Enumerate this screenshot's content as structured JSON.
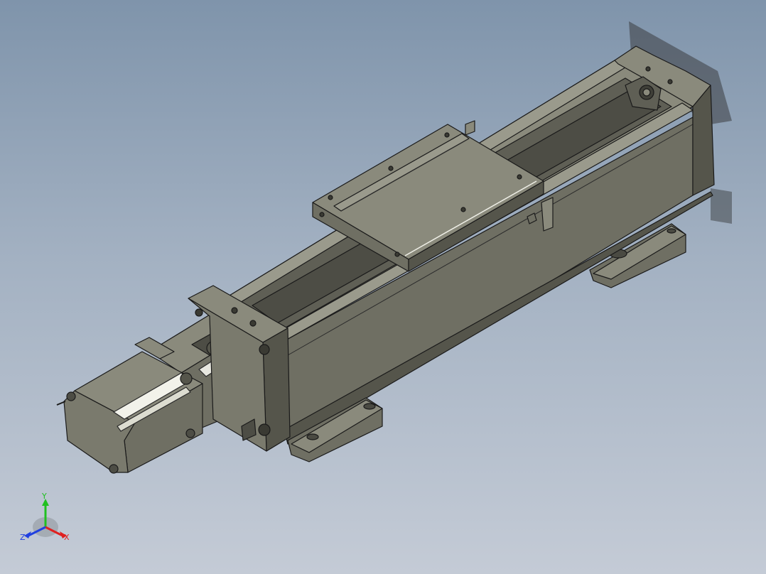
{
  "window": {
    "title": ""
  },
  "triad": {
    "x_label": "X",
    "y_label": "Y",
    "z_label": "Z",
    "x_color": "#e02020",
    "y_color": "#20c020",
    "z_color": "#2040e0"
  },
  "model": {
    "name": "linear-actuator-module",
    "parts": [
      "stepper-motor",
      "coupling-housing",
      "end-plate-motor",
      "aluminum-profile-body",
      "carriage-slider",
      "end-plate-idler",
      "mounting-foot-front",
      "mounting-foot-rear"
    ]
  },
  "colors": {
    "background_top": "#7f94ab",
    "background_bottom": "#c4cbd6",
    "part_face_light": "#8a8a7c",
    "part_face_mid": "#6f6f63",
    "part_face_dark": "#55554b",
    "edge": "#1a1a1a"
  }
}
